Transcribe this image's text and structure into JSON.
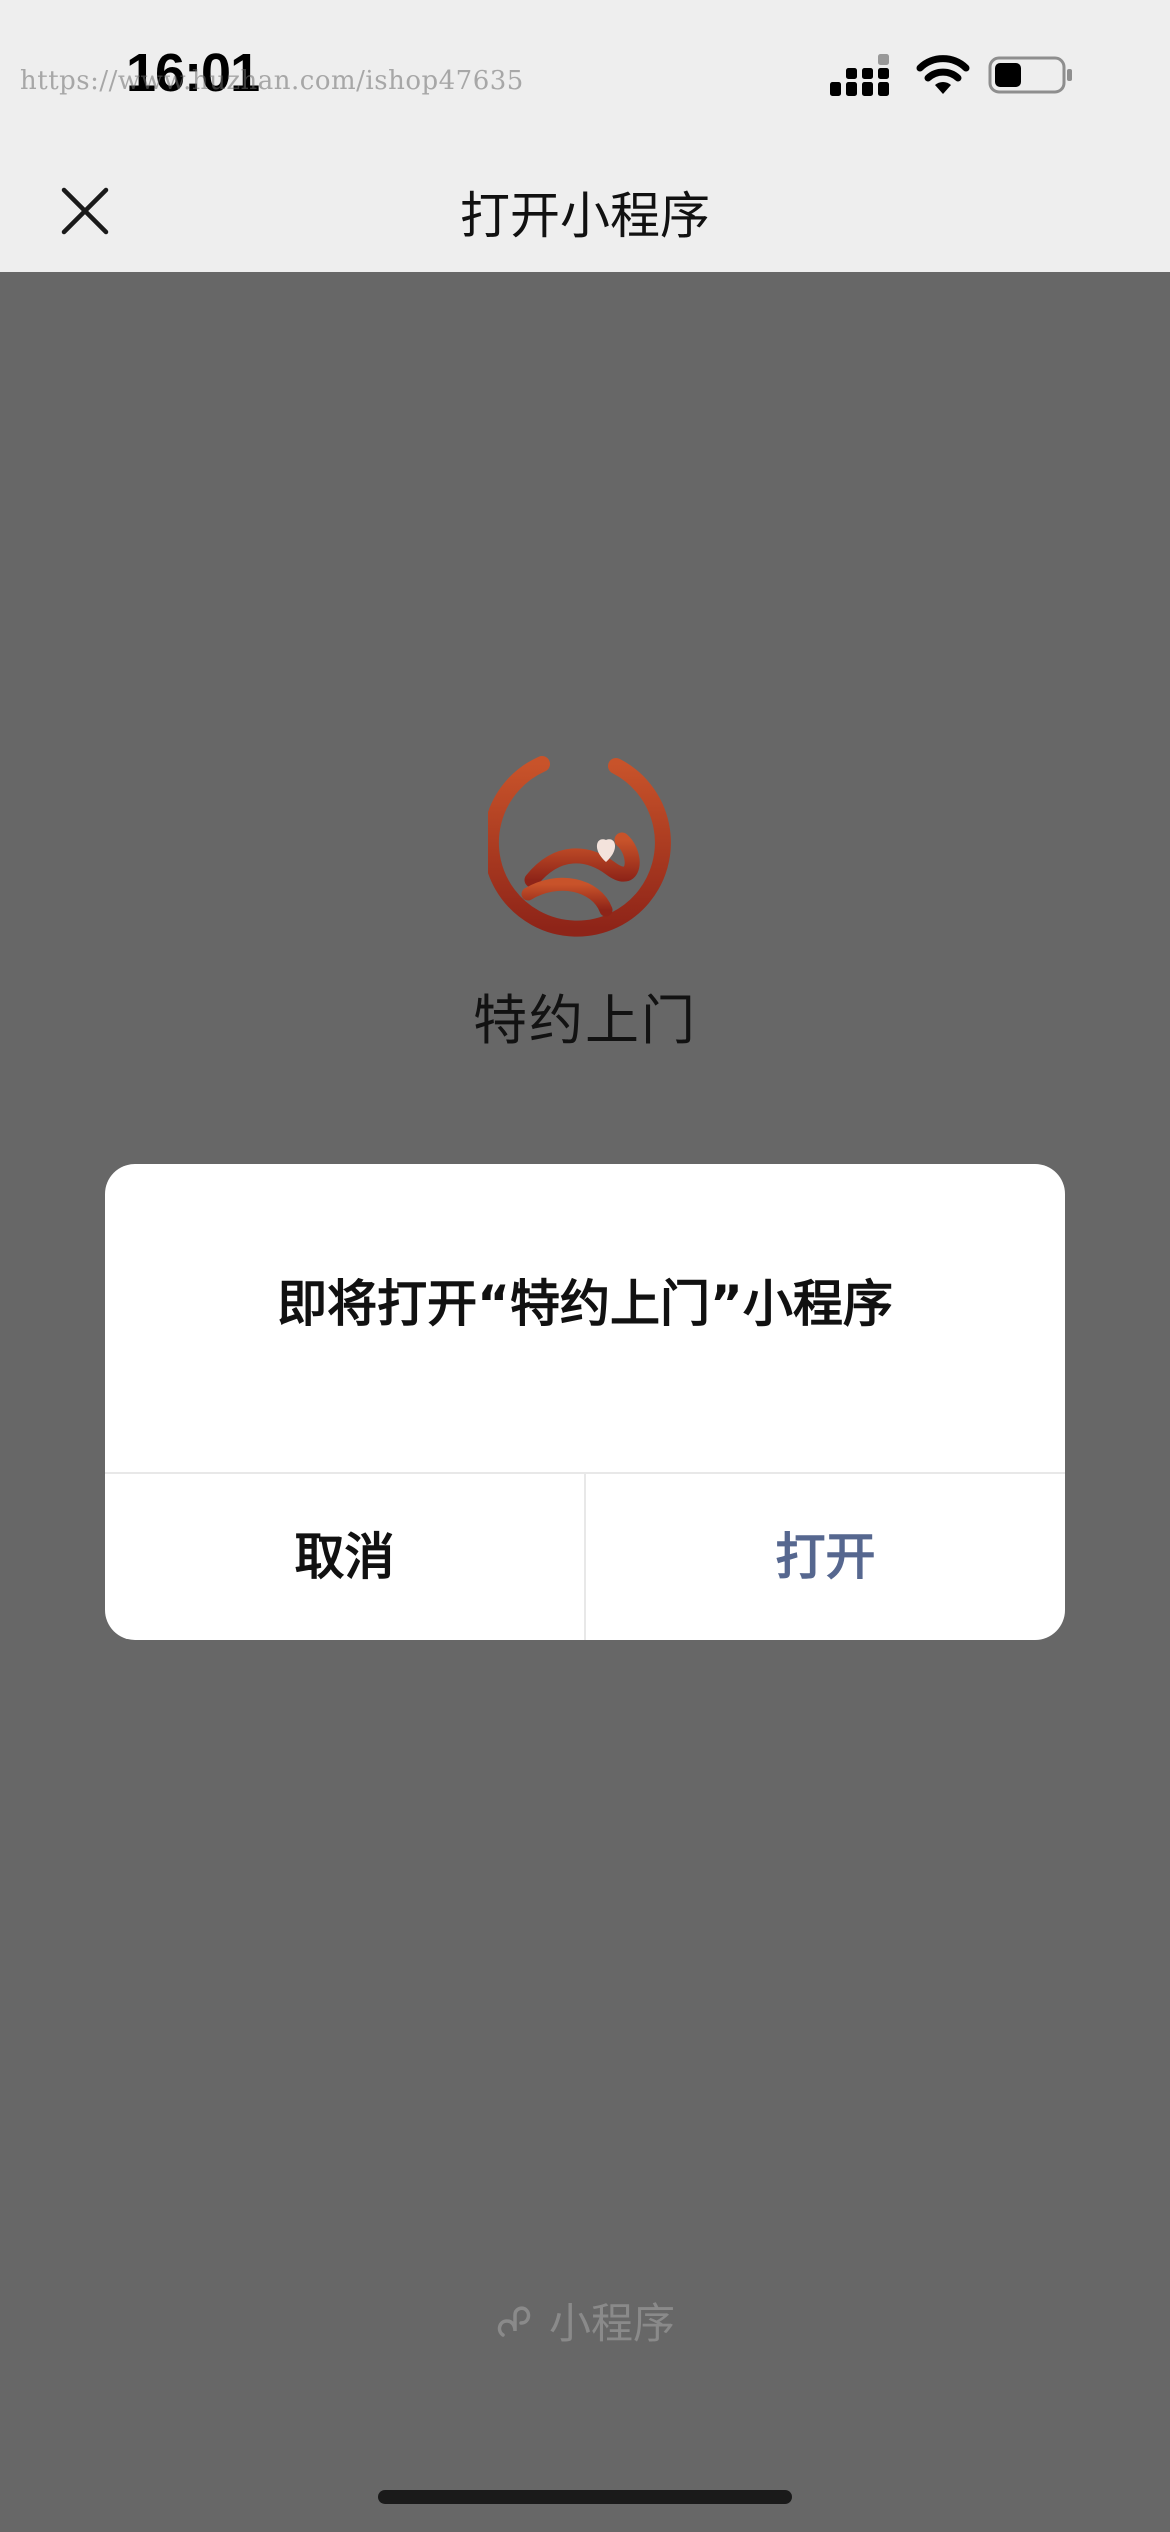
{
  "status_bar": {
    "time": "16:01",
    "watermark": "https://www.huzhan.com/ishop47635"
  },
  "nav": {
    "title": "打开小程序"
  },
  "app": {
    "name": "特约上门",
    "logo_colors": {
      "top": "#c8532a",
      "bottom": "#8e2418"
    }
  },
  "dialog": {
    "message": "即将打开“特约上门”小程序",
    "cancel_label": "取消",
    "open_label": "打开",
    "open_color": "#56678f"
  },
  "footer": {
    "label": "小程序"
  },
  "colors": {
    "overlay_background": "#676767",
    "top_background": "#eeeeee"
  }
}
